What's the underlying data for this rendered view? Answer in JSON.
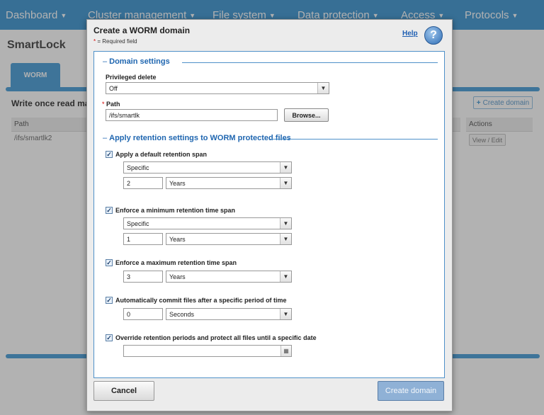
{
  "nav": {
    "items": [
      {
        "label": "Dashboard"
      },
      {
        "label": "Cluster management"
      },
      {
        "label": "File system"
      },
      {
        "label": "Data protection"
      },
      {
        "label": "Access"
      },
      {
        "label": "Protocols"
      }
    ],
    "caret": "▼"
  },
  "background": {
    "page_title": "SmartLock",
    "tab_label": "WORM",
    "subtitle": "Write once read mar",
    "create_domain": "Create domain",
    "table": {
      "headers": [
        "Path",
        "Actions"
      ],
      "rows": [
        {
          "path": "/ifs/smartlk2",
          "action": "View / Edit"
        }
      ]
    }
  },
  "modal": {
    "title": "Create a WORM domain",
    "required_note": "= Required field",
    "help_label": "Help",
    "help_icon": "?",
    "domain_settings": {
      "header": "Domain settings",
      "privileged_delete_label": "Privileged delete",
      "privileged_delete_value": "Off",
      "path_label": "Path",
      "path_value": "/ifs/smartlk",
      "browse_label": "Browse..."
    },
    "retention": {
      "header": "Apply retention settings to WORM protected files",
      "default_span": {
        "label": "Apply a default retention span",
        "checked": true,
        "mode": "Specific",
        "amount": "2",
        "unit": "Years"
      },
      "minimum_span": {
        "label": "Enforce a minimum retention time span",
        "checked": true,
        "mode": "Specific",
        "amount": "1",
        "unit": "Years"
      },
      "maximum_span": {
        "label": "Enforce a maximum retention time span",
        "checked": true,
        "amount": "3",
        "unit": "Years"
      },
      "autocommit": {
        "label": "Automatically commit files after a specific period of time",
        "checked": true,
        "amount": "0",
        "unit": "Seconds"
      },
      "override": {
        "label": "Override retention periods and protect all files until a specific date",
        "checked": true,
        "date": ""
      }
    },
    "cancel_label": "Cancel",
    "create_label": "Create domain"
  },
  "glyphs": {
    "check": "✓",
    "arrow": "▼",
    "plus": "+",
    "calendar": "▦"
  },
  "colors": {
    "nav": "#4f9fd6",
    "accent": "#1f66b0",
    "required": "#d40000"
  }
}
